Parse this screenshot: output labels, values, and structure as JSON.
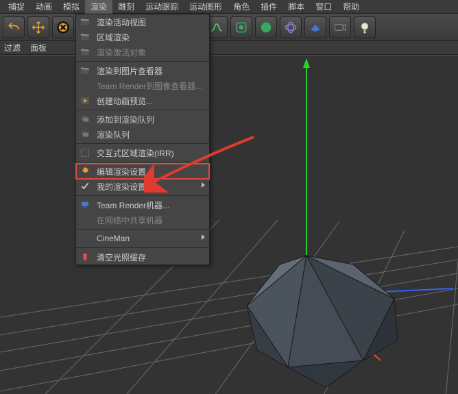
{
  "menubar": {
    "items": [
      "捕捉",
      "动画",
      "模拟",
      "渲染",
      "雕刻",
      "运动跟踪",
      "运动图形",
      "角色",
      "插件",
      "脚本",
      "窗口",
      "帮助"
    ],
    "active_index": 3
  },
  "toolbar_icons": [
    "undo-icon",
    "move-icon",
    "close-icon",
    "render1-icon",
    "render2-icon",
    "render3-icon",
    "settings-icon",
    "cube-icon",
    "spline-icon",
    "deform-icon",
    "sphere-icon",
    "field-icon",
    "plane-icon",
    "camera-icon",
    "light-icon"
  ],
  "subbar": {
    "items": [
      "过滤",
      "面板"
    ]
  },
  "dropdown": {
    "groups": [
      [
        {
          "label": "渲染活动视图",
          "icon": "clapper-icon"
        },
        {
          "label": "区域渲染",
          "icon": "clapper-icon"
        },
        {
          "label": "渲染激活对象",
          "icon": "clapper-icon",
          "disabled": true
        }
      ],
      [
        {
          "label": "渲染到图片查看器",
          "icon": "clapper-icon"
        },
        {
          "label": "Team Render到图像查看器...",
          "disabled": true
        },
        {
          "label": "创建动画预览...",
          "icon": "play-icon"
        }
      ],
      [
        {
          "label": "添加到渲染队列",
          "icon": "queue-icon"
        },
        {
          "label": "渲染队列",
          "icon": "queue-icon"
        }
      ],
      [
        {
          "label": "交互式区域渲染(IRR)",
          "icon": "region-icon"
        }
      ],
      [
        {
          "label": "编辑渲染设置...",
          "icon": "gear-icon",
          "highlight": true
        },
        {
          "label": "我的渲染设置",
          "icon": "check-icon",
          "submenu": true
        }
      ],
      [
        {
          "label": "Team Render机器...",
          "icon": "monitor-icon"
        },
        {
          "label": "在网络中共享机器",
          "disabled": true
        }
      ],
      [
        {
          "label": "CineMan",
          "submenu": true
        }
      ],
      [
        {
          "label": "清空光照缓存",
          "icon": "flush-icon"
        }
      ]
    ]
  }
}
